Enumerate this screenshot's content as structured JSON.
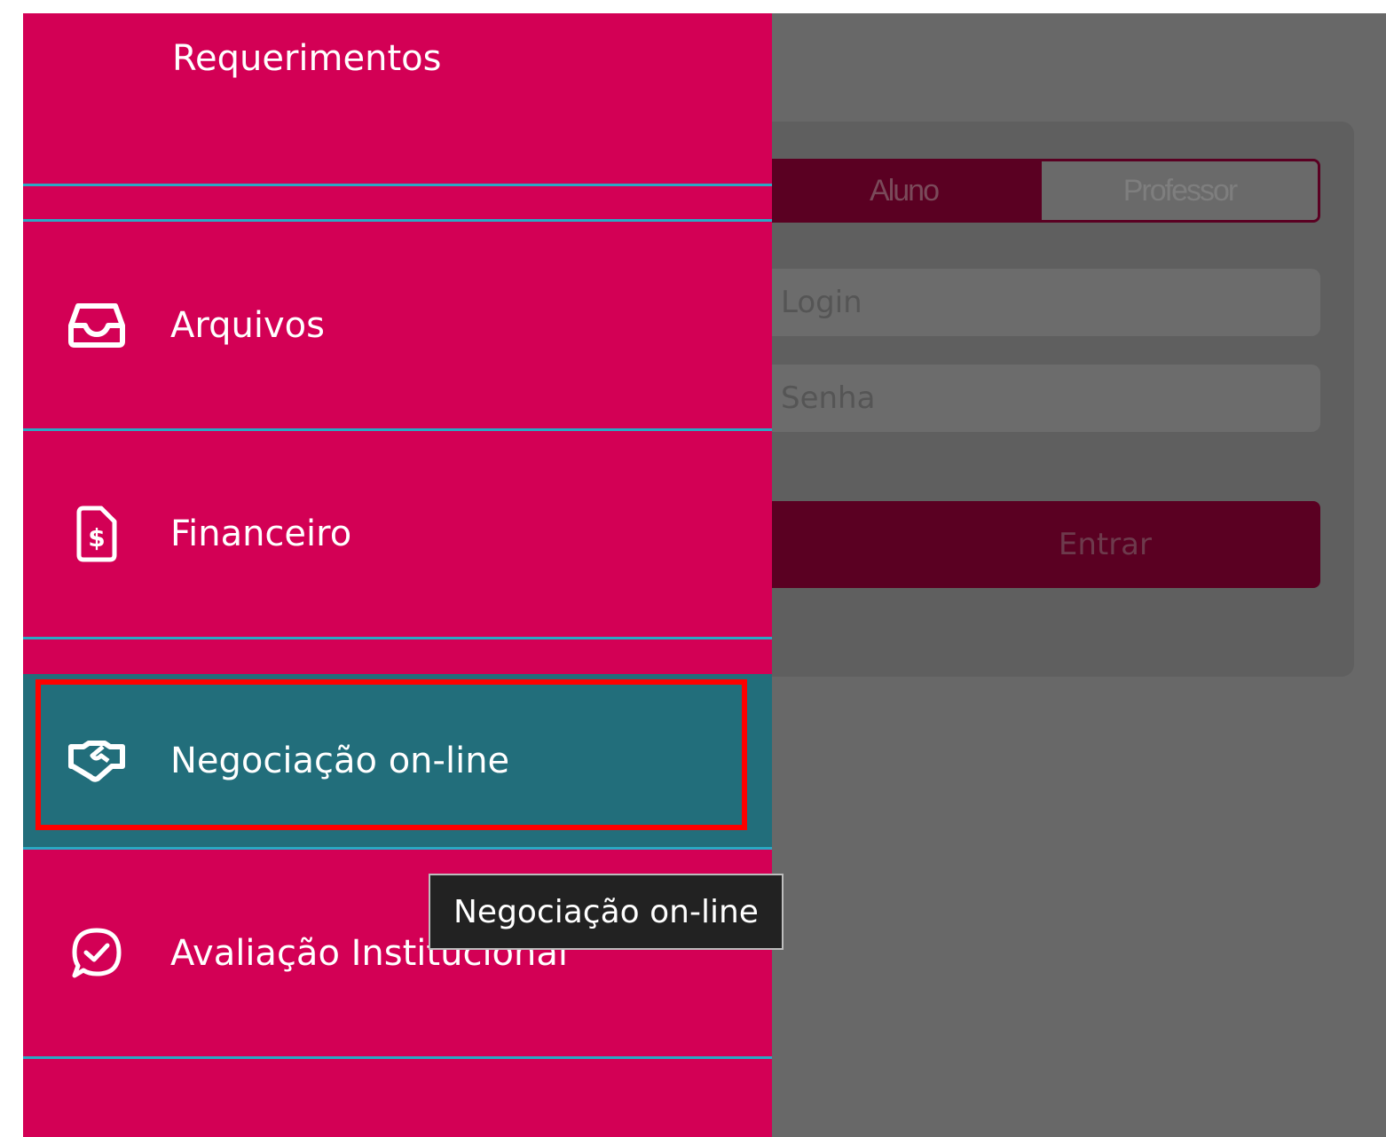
{
  "login": {
    "role_student": "Aluno",
    "role_teacher": "Professor",
    "login_placeholder": "Login",
    "password_placeholder": "Senha",
    "submit_label": "Entrar"
  },
  "menu": {
    "items": [
      {
        "label": "Requerimentos",
        "icon": ""
      },
      {
        "label": "Arquivos",
        "icon": "inbox-icon"
      },
      {
        "label": "Financeiro",
        "icon": "dollar-document-icon"
      },
      {
        "label": "Negociação on-line",
        "icon": "handshake-icon"
      },
      {
        "label": "Avaliação Institucional",
        "icon": "chat-check-icon"
      }
    ]
  },
  "tooltip": {
    "text": "Negociação on-line"
  },
  "colors": {
    "menu_bg": "#d30055",
    "menu_active_bg": "#226e7b",
    "divider": "#2aa9c4",
    "highlight": "#ff0000"
  }
}
